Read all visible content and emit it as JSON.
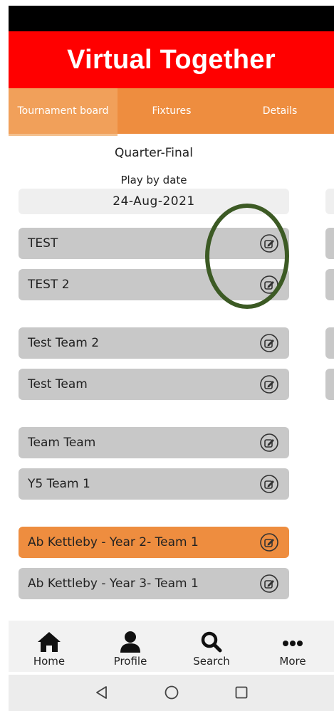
{
  "app": {
    "title": "Virtual Together"
  },
  "tabs": [
    {
      "label": "Tournament board",
      "active": true
    },
    {
      "label": "Fixtures",
      "active": false
    },
    {
      "label": "Details",
      "active": false
    }
  ],
  "round": {
    "title": "Quarter-Final",
    "play_by_label": "Play by date",
    "play_by_date": "24-Aug-2021"
  },
  "matches": [
    {
      "teams": [
        {
          "name": "TEST",
          "highlight": false
        },
        {
          "name": "TEST 2",
          "highlight": false
        }
      ]
    },
    {
      "teams": [
        {
          "name": "Test Team 2",
          "highlight": false
        },
        {
          "name": "Test Team",
          "highlight": false
        }
      ]
    },
    {
      "teams": [
        {
          "name": "Team Team",
          "highlight": false
        },
        {
          "name": "Y5 Team 1",
          "highlight": false
        }
      ]
    },
    {
      "teams": [
        {
          "name": "Ab Kettleby - Year 2- Team 1",
          "highlight": true
        },
        {
          "name": "Ab Kettleby - Year 3- Team 1",
          "highlight": false
        }
      ]
    }
  ],
  "bottom_nav": [
    {
      "label": "Home",
      "icon": "home-icon"
    },
    {
      "label": "Profile",
      "icon": "profile-icon"
    },
    {
      "label": "Search",
      "icon": "search-icon"
    },
    {
      "label": "More",
      "icon": "more-icon"
    }
  ],
  "colors": {
    "title_bar": "#ff0000",
    "tab_bar": "#ee8d3f",
    "team_row": "#c8c8c8",
    "team_highlight": "#ee8d3f",
    "focus_ring": "#3c5a24"
  }
}
